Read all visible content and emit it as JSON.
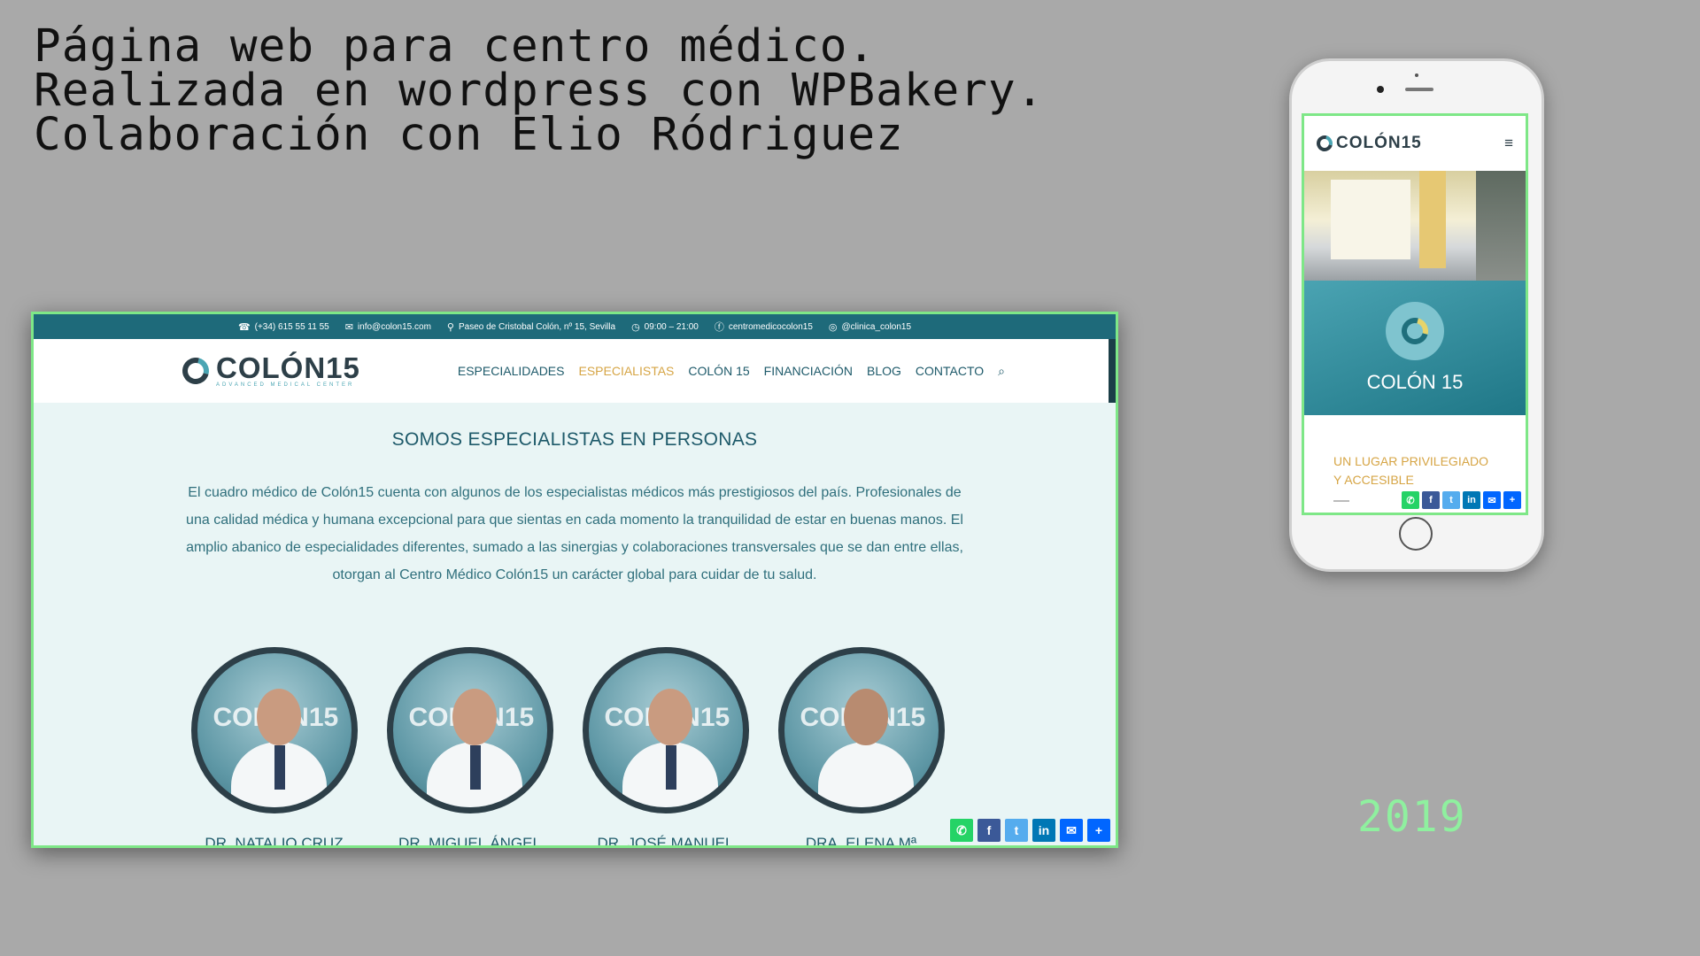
{
  "caption": {
    "line1": "Página web para centro médico.",
    "line2": "Realizada en wordpress con WPBakery.",
    "line3": "Colaboración con Elio Ródriguez"
  },
  "year": "2019",
  "desktop": {
    "topbar": {
      "phone": "(+34) 615 55 11 55",
      "email": "info@colon15.com",
      "address": "Paseo de Cristobal Colón, nº 15, Sevilla",
      "hours": "09:00 – 21:00",
      "facebook": "centromedicocolon15",
      "instagram": "@clinica_colon15"
    },
    "logo": {
      "name": "COLÓN15",
      "subtitle": "ADVANCED MEDICAL CENTER"
    },
    "menu": [
      "ESPECIALIDADES",
      "ESPECIALISTAS",
      "COLÓN 15",
      "FINANCIACIÓN",
      "BLOG",
      "CONTACTO"
    ],
    "active_menu": "ESPECIALISTAS",
    "section_title": "SOMOS ESPECIALISTAS EN PERSONAS",
    "section_text": "El cuadro médico de Colón15 cuenta con algunos de los especialistas médicos más prestigiosos del país. Profesionales de una calidad médica y humana excepcional para que sientas en cada momento la tranquilidad de estar en buenas manos. El amplio abanico de especialidades diferentes, sumado a las sinergias y colaboraciones transversales que se dan entre ellas, otorgan al Centro Médico Colón15 un carácter global para cuidar de tu salud.",
    "portrait_watermark": "COLÓN15",
    "doctors": [
      {
        "name": "DR. NATALIO CRUZ"
      },
      {
        "name": "DR. MIGUEL ÁNGEL"
      },
      {
        "name": "DR. JOSÉ MANUEL"
      },
      {
        "name": "DRA. ELENA Mª"
      }
    ]
  },
  "mobile": {
    "logo": "COLÓN15",
    "hero_title": "COLÓN 15",
    "tagline": "UN LUGAR PRIVILEGIADO\nY ACCESIBLE"
  },
  "colors": {
    "background": "#a9a9a9",
    "teal_dark": "#1e6a7a",
    "accent_gold": "#d6a545",
    "frame_green": "#7ee787",
    "year_green": "#8ff09f"
  },
  "share_icons": [
    "whatsapp-icon",
    "facebook-icon",
    "twitter-icon",
    "linkedin-icon",
    "email-icon",
    "share-plus-icon"
  ]
}
